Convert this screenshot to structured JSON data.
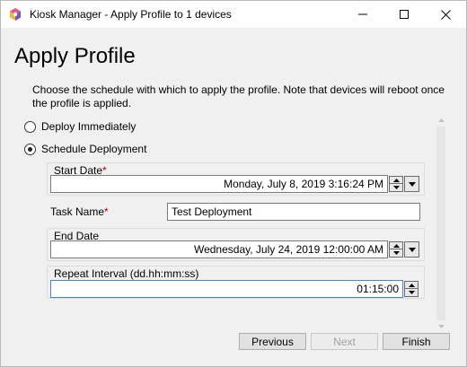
{
  "window": {
    "title": "Kiosk Manager - Apply Profile to 1 devices",
    "app_icon": "kiosk-manager-icon",
    "controls": {
      "minimize_icon": "minimize-icon",
      "maximize_icon": "maximize-icon",
      "close_icon": "close-icon"
    }
  },
  "page": {
    "title": "Apply Profile",
    "description": "Choose the schedule with which to apply the profile. Note that devices will reboot once the profile is applied."
  },
  "schedule": {
    "options": [
      {
        "label": "Deploy Immediately",
        "selected": false
      },
      {
        "label": "Schedule Deployment",
        "selected": true
      }
    ]
  },
  "form": {
    "start_date": {
      "label": "Start Date",
      "required_mark": "*",
      "value": "Monday, July 8, 2019 3:16:24 PM"
    },
    "task_name": {
      "label": "Task Name",
      "required_mark": "*",
      "value": "Test Deployment"
    },
    "end_date": {
      "label": "End Date",
      "value": "Wednesday, July 24, 2019 12:00:00 AM"
    },
    "repeat_interval": {
      "label": "Repeat Interval (dd.hh:mm:ss)",
      "value": "01:15:00"
    }
  },
  "buttons": {
    "previous": "Previous",
    "next": "Next",
    "finish": "Finish"
  },
  "colors": {
    "required": "#c00000",
    "focus_border": "#4a87c6",
    "disabled_text": "#a0a0a0"
  }
}
